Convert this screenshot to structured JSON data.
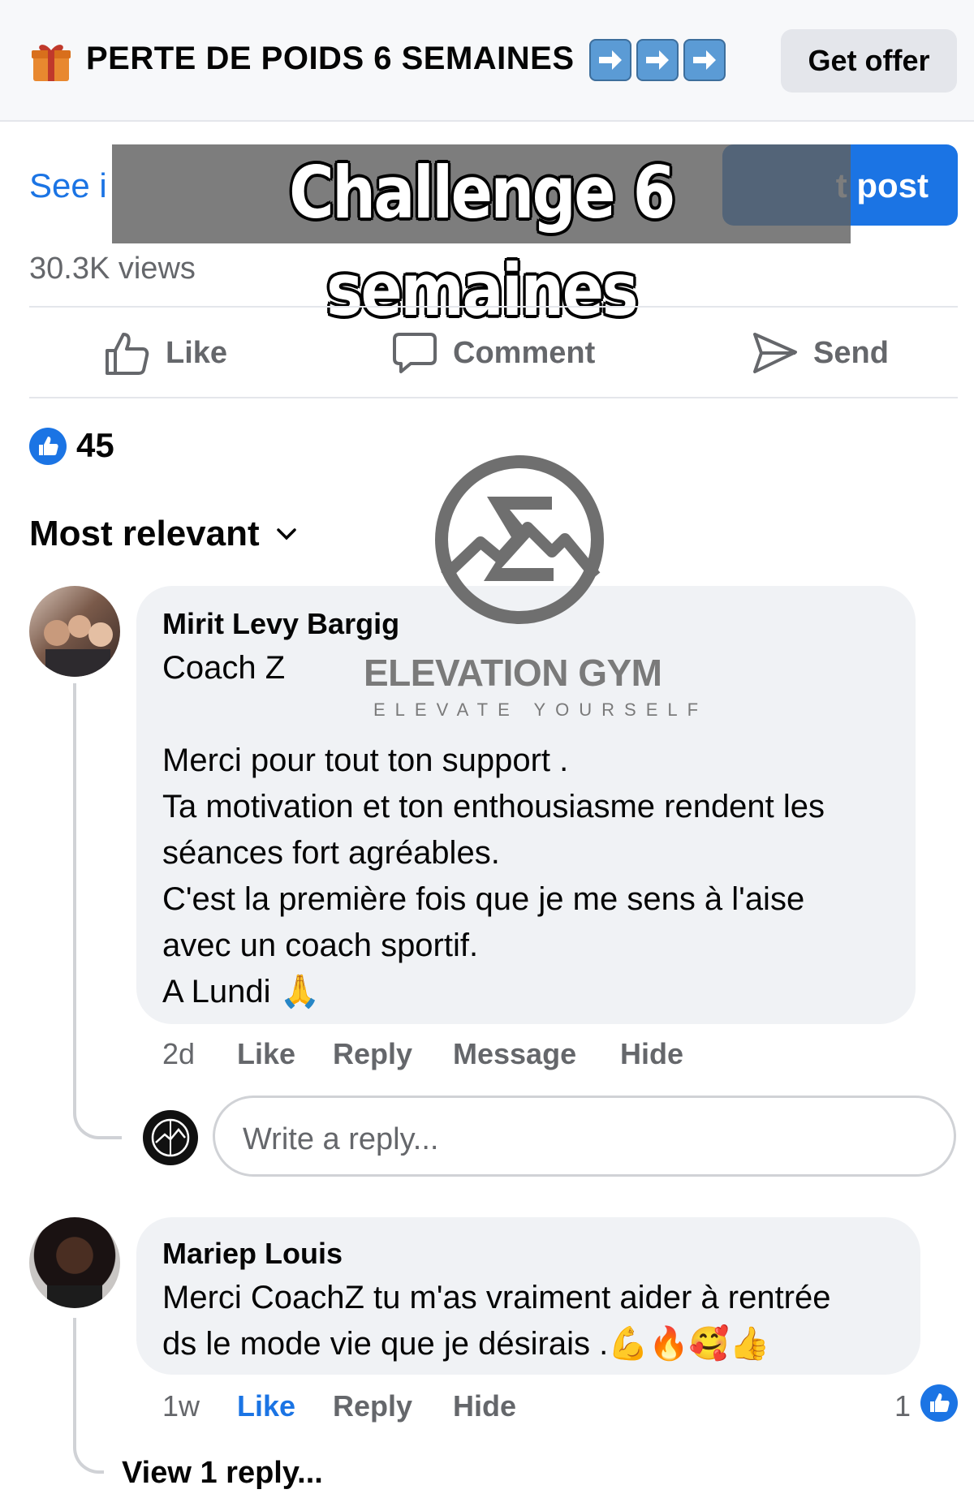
{
  "offer": {
    "title": "PERTE DE POIDS 6 SEMAINES",
    "arrow_icons": [
      "right-arrow-icon",
      "right-arrow-icon",
      "right-arrow-icon"
    ],
    "cta": "Get offer"
  },
  "post": {
    "insights_link": "See i",
    "boost_label": "t post",
    "overlay_text": "Challenge 6 semaines",
    "views": "30.3K views"
  },
  "actions": [
    {
      "label": "Like",
      "icon": "thumbs-up-icon"
    },
    {
      "label": "Comment",
      "icon": "speech-bubble-icon"
    },
    {
      "label": "Send",
      "icon": "send-icon"
    }
  ],
  "reactions": {
    "count": "45"
  },
  "sort": {
    "label": "Most relevant"
  },
  "watermark": {
    "name": "ELEVATION GYM",
    "tagline": "ELEVATE YOURSELF"
  },
  "comments": [
    {
      "author": "Mirit Levy Bargig",
      "lines": [
        "Coach Z",
        "",
        "Merci pour tout ton support .",
        "Ta motivation et ton enthousiasme rendent les",
        "séances fort agréables.",
        "C'est la première fois que je me sens à l'aise",
        "avec un coach sportif.",
        "A Lundi 🙏"
      ],
      "time": "2d",
      "actions": [
        "Like",
        "Reply",
        "Message",
        "Hide"
      ]
    },
    {
      "author": "Mariep Louis",
      "lines": [
        "Merci CoachZ tu m'as vraiment aider à rentrée",
        "ds le mode vie que je désirais .💪🔥🥰👍"
      ],
      "time": "1w",
      "actions": [
        "Like",
        "Reply",
        "Hide"
      ],
      "like_count": "1"
    }
  ],
  "reply_box": {
    "placeholder": "Write a reply..."
  },
  "view_replies": "View 1 reply...",
  "colors": {
    "accent": "#1b74e4",
    "muted": "#65676b",
    "bubble": "#f0f2f5"
  }
}
